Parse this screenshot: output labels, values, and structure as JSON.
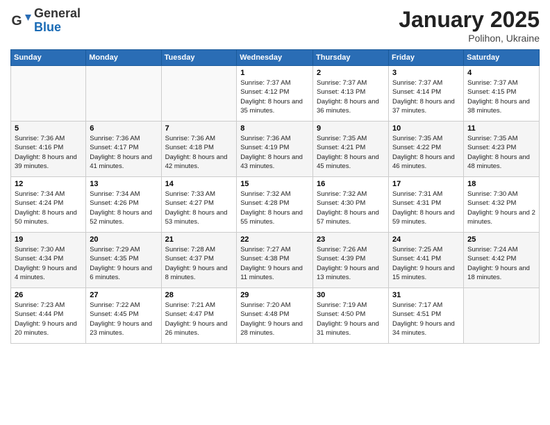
{
  "header": {
    "logo": {
      "general": "General",
      "blue": "Blue"
    },
    "title": "January 2025",
    "location": "Polihon, Ukraine"
  },
  "calendar": {
    "weekdays": [
      "Sunday",
      "Monday",
      "Tuesday",
      "Wednesday",
      "Thursday",
      "Friday",
      "Saturday"
    ],
    "weeks": [
      [
        {
          "day": "",
          "info": ""
        },
        {
          "day": "",
          "info": ""
        },
        {
          "day": "",
          "info": ""
        },
        {
          "day": "1",
          "info": "Sunrise: 7:37 AM\nSunset: 4:12 PM\nDaylight: 8 hours\nand 35 minutes."
        },
        {
          "day": "2",
          "info": "Sunrise: 7:37 AM\nSunset: 4:13 PM\nDaylight: 8 hours\nand 36 minutes."
        },
        {
          "day": "3",
          "info": "Sunrise: 7:37 AM\nSunset: 4:14 PM\nDaylight: 8 hours\nand 37 minutes."
        },
        {
          "day": "4",
          "info": "Sunrise: 7:37 AM\nSunset: 4:15 PM\nDaylight: 8 hours\nand 38 minutes."
        }
      ],
      [
        {
          "day": "5",
          "info": "Sunrise: 7:36 AM\nSunset: 4:16 PM\nDaylight: 8 hours\nand 39 minutes."
        },
        {
          "day": "6",
          "info": "Sunrise: 7:36 AM\nSunset: 4:17 PM\nDaylight: 8 hours\nand 41 minutes."
        },
        {
          "day": "7",
          "info": "Sunrise: 7:36 AM\nSunset: 4:18 PM\nDaylight: 8 hours\nand 42 minutes."
        },
        {
          "day": "8",
          "info": "Sunrise: 7:36 AM\nSunset: 4:19 PM\nDaylight: 8 hours\nand 43 minutes."
        },
        {
          "day": "9",
          "info": "Sunrise: 7:35 AM\nSunset: 4:21 PM\nDaylight: 8 hours\nand 45 minutes."
        },
        {
          "day": "10",
          "info": "Sunrise: 7:35 AM\nSunset: 4:22 PM\nDaylight: 8 hours\nand 46 minutes."
        },
        {
          "day": "11",
          "info": "Sunrise: 7:35 AM\nSunset: 4:23 PM\nDaylight: 8 hours\nand 48 minutes."
        }
      ],
      [
        {
          "day": "12",
          "info": "Sunrise: 7:34 AM\nSunset: 4:24 PM\nDaylight: 8 hours\nand 50 minutes."
        },
        {
          "day": "13",
          "info": "Sunrise: 7:34 AM\nSunset: 4:26 PM\nDaylight: 8 hours\nand 52 minutes."
        },
        {
          "day": "14",
          "info": "Sunrise: 7:33 AM\nSunset: 4:27 PM\nDaylight: 8 hours\nand 53 minutes."
        },
        {
          "day": "15",
          "info": "Sunrise: 7:32 AM\nSunset: 4:28 PM\nDaylight: 8 hours\nand 55 minutes."
        },
        {
          "day": "16",
          "info": "Sunrise: 7:32 AM\nSunset: 4:30 PM\nDaylight: 8 hours\nand 57 minutes."
        },
        {
          "day": "17",
          "info": "Sunrise: 7:31 AM\nSunset: 4:31 PM\nDaylight: 8 hours\nand 59 minutes."
        },
        {
          "day": "18",
          "info": "Sunrise: 7:30 AM\nSunset: 4:32 PM\nDaylight: 9 hours\nand 2 minutes."
        }
      ],
      [
        {
          "day": "19",
          "info": "Sunrise: 7:30 AM\nSunset: 4:34 PM\nDaylight: 9 hours\nand 4 minutes."
        },
        {
          "day": "20",
          "info": "Sunrise: 7:29 AM\nSunset: 4:35 PM\nDaylight: 9 hours\nand 6 minutes."
        },
        {
          "day": "21",
          "info": "Sunrise: 7:28 AM\nSunset: 4:37 PM\nDaylight: 9 hours\nand 8 minutes."
        },
        {
          "day": "22",
          "info": "Sunrise: 7:27 AM\nSunset: 4:38 PM\nDaylight: 9 hours\nand 11 minutes."
        },
        {
          "day": "23",
          "info": "Sunrise: 7:26 AM\nSunset: 4:39 PM\nDaylight: 9 hours\nand 13 minutes."
        },
        {
          "day": "24",
          "info": "Sunrise: 7:25 AM\nSunset: 4:41 PM\nDaylight: 9 hours\nand 15 minutes."
        },
        {
          "day": "25",
          "info": "Sunrise: 7:24 AM\nSunset: 4:42 PM\nDaylight: 9 hours\nand 18 minutes."
        }
      ],
      [
        {
          "day": "26",
          "info": "Sunrise: 7:23 AM\nSunset: 4:44 PM\nDaylight: 9 hours\nand 20 minutes."
        },
        {
          "day": "27",
          "info": "Sunrise: 7:22 AM\nSunset: 4:45 PM\nDaylight: 9 hours\nand 23 minutes."
        },
        {
          "day": "28",
          "info": "Sunrise: 7:21 AM\nSunset: 4:47 PM\nDaylight: 9 hours\nand 26 minutes."
        },
        {
          "day": "29",
          "info": "Sunrise: 7:20 AM\nSunset: 4:48 PM\nDaylight: 9 hours\nand 28 minutes."
        },
        {
          "day": "30",
          "info": "Sunrise: 7:19 AM\nSunset: 4:50 PM\nDaylight: 9 hours\nand 31 minutes."
        },
        {
          "day": "31",
          "info": "Sunrise: 7:17 AM\nSunset: 4:51 PM\nDaylight: 9 hours\nand 34 minutes."
        },
        {
          "day": "",
          "info": ""
        }
      ]
    ]
  }
}
